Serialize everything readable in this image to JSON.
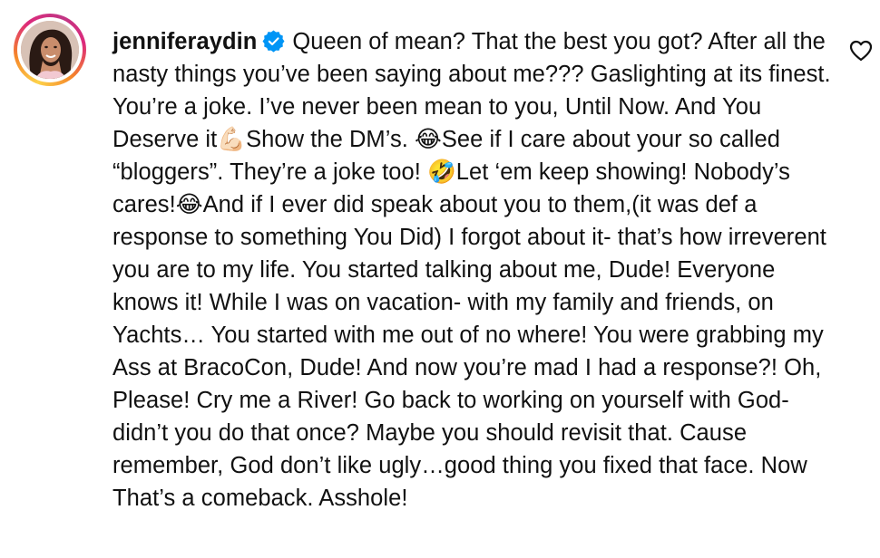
{
  "comment": {
    "username": "jenniferaydin",
    "verified_icon": "verified-badge-icon",
    "like_icon": "heart-outline-icon",
    "text": "Queen of mean? That the best you got? After all the nasty things you’ve been saying about me??? Gaslighting at its finest. You’re a joke. I’ve never been mean to you, Until Now. And You Deserve it💪🏻Show the DM’s. 😂See if I care about your so called “bloggers”. They’re a joke too! 🤣Let ‘em keep showing! Nobody’s cares!😂And if I ever did speak about you to them,(it was def a response to something You Did) I forgot about it- that’s how irreverent you are to my life. You started talking about me, Dude! Everyone knows it! While I was on vacation- with my family and friends, on Yachts… You started with me out of no where! You were grabbing my Ass at BracoCon, Dude! And now you’re mad I had a response?! Oh, Please! Cry me a River! Go back to working on yourself with God- didn’t you do that once? Maybe you should revisit that. Cause remember, God don’t like ugly…good thing you fixed that face. Now That’s a comeback. Asshole!"
  },
  "colors": {
    "text": "#111111",
    "verified": "#0095f6",
    "ring_start": "#fdd24a",
    "ring_end": "#dd2a7b"
  }
}
